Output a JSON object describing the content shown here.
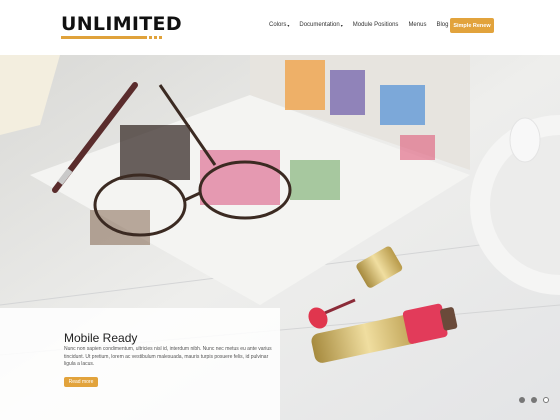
{
  "brand": {
    "name": "UNLIMITED"
  },
  "nav": {
    "items": [
      {
        "label": "Colors",
        "has_dropdown": true
      },
      {
        "label": "Documentation",
        "has_dropdown": true
      },
      {
        "label": "Module Positions",
        "has_dropdown": false
      },
      {
        "label": "Menus",
        "has_dropdown": false
      },
      {
        "label": "Blog",
        "has_dropdown": false
      }
    ],
    "cta_label": "Simple Renew",
    "caret": "▾"
  },
  "slide": {
    "title": "Mobile Ready",
    "text": "Nunc non sapien condimentum, ultricies nisl id, interdum nibh. Nunc nec metus eu ante varius tincidunt. Ut pretium, lorem ac vestibulum malesuada, mauris turpis posuere felis, id pulvinar ligula a lacus.",
    "button_label": "Read more"
  },
  "slider": {
    "dot_count": 3,
    "active_index": 2
  },
  "colors": {
    "accent": "#e2a33c",
    "text_dark": "#222222"
  }
}
